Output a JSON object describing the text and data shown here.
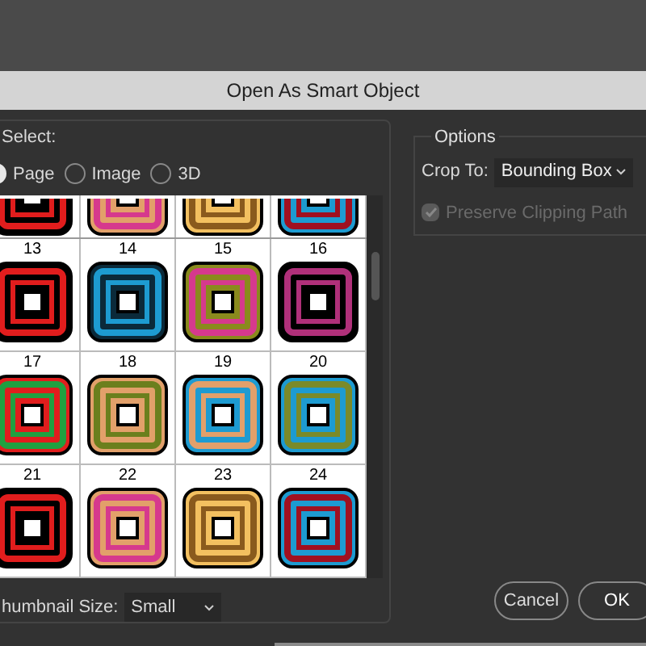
{
  "window": {
    "title": "Open As Smart Object"
  },
  "select": {
    "label": "Select:",
    "options": [
      {
        "label": "Page",
        "selected": true
      },
      {
        "label": "Image",
        "selected": false
      },
      {
        "label": "3D",
        "selected": false
      }
    ]
  },
  "thumbnails": {
    "numbered": [
      {
        "label": "13"
      },
      {
        "label": "14"
      },
      {
        "label": "15"
      },
      {
        "label": "16"
      },
      {
        "label": "17"
      },
      {
        "label": "18"
      },
      {
        "label": "19"
      },
      {
        "label": "20"
      },
      {
        "label": "21"
      },
      {
        "label": "22"
      },
      {
        "label": "23"
      },
      {
        "label": "24"
      }
    ]
  },
  "thumbnail_size": {
    "label": "humbnail Size:",
    "value": "Small"
  },
  "options": {
    "title": "Options",
    "crop_to": {
      "label": "Crop To:",
      "value": "Bounding Box"
    },
    "preserve_clipping_path": {
      "label": "Preserve Clipping Path",
      "checked": true,
      "disabled": true
    }
  },
  "buttons": [
    {
      "label": "Cancel",
      "kind": "secondary"
    },
    {
      "label": "OK",
      "kind": "primary"
    }
  ]
}
